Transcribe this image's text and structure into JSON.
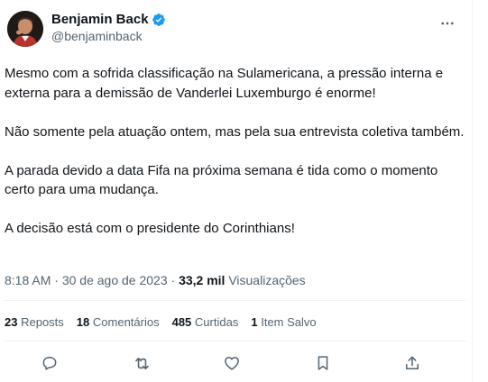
{
  "author": {
    "name": "Benjamin Back",
    "handle": "@benjaminback",
    "verified": true,
    "verified_color": "#1d9bf0"
  },
  "tweet": {
    "paragraphs": [
      "Mesmo com a sofrida classificação na Sulamericana, a pressão interna e externa para a demissão de Vanderlei Luxemburgo é enorme!",
      "Não somente pela atuação ontem, mas pela sua entrevista coletiva também.",
      "A parada devido a data Fifa na próxima semana é tida como o momento certo para uma mudança.",
      "A decisão está com o presidente do Corinthians!"
    ],
    "time": "8:18 AM",
    "separator": "·",
    "date": "30 de ago de 2023",
    "views_count": "33,2 mil",
    "views_label": "Visualizações"
  },
  "stats": {
    "reposts_count": "23",
    "reposts_label": "Reposts",
    "comments_count": "18",
    "comments_label": "Comentários",
    "likes_count": "485",
    "likes_label": "Curtidas",
    "bookmarks_count": "1",
    "bookmarks_label": "Item Salvo"
  },
  "icons": {
    "more": "more-horizontal-icon",
    "reply": "reply-icon",
    "retweet": "retweet-icon",
    "like": "heart-icon",
    "bookmark": "bookmark-icon",
    "share": "share-icon"
  },
  "colors": {
    "text": "#0f1419",
    "secondary": "#536471",
    "divider": "#eff3f4"
  }
}
